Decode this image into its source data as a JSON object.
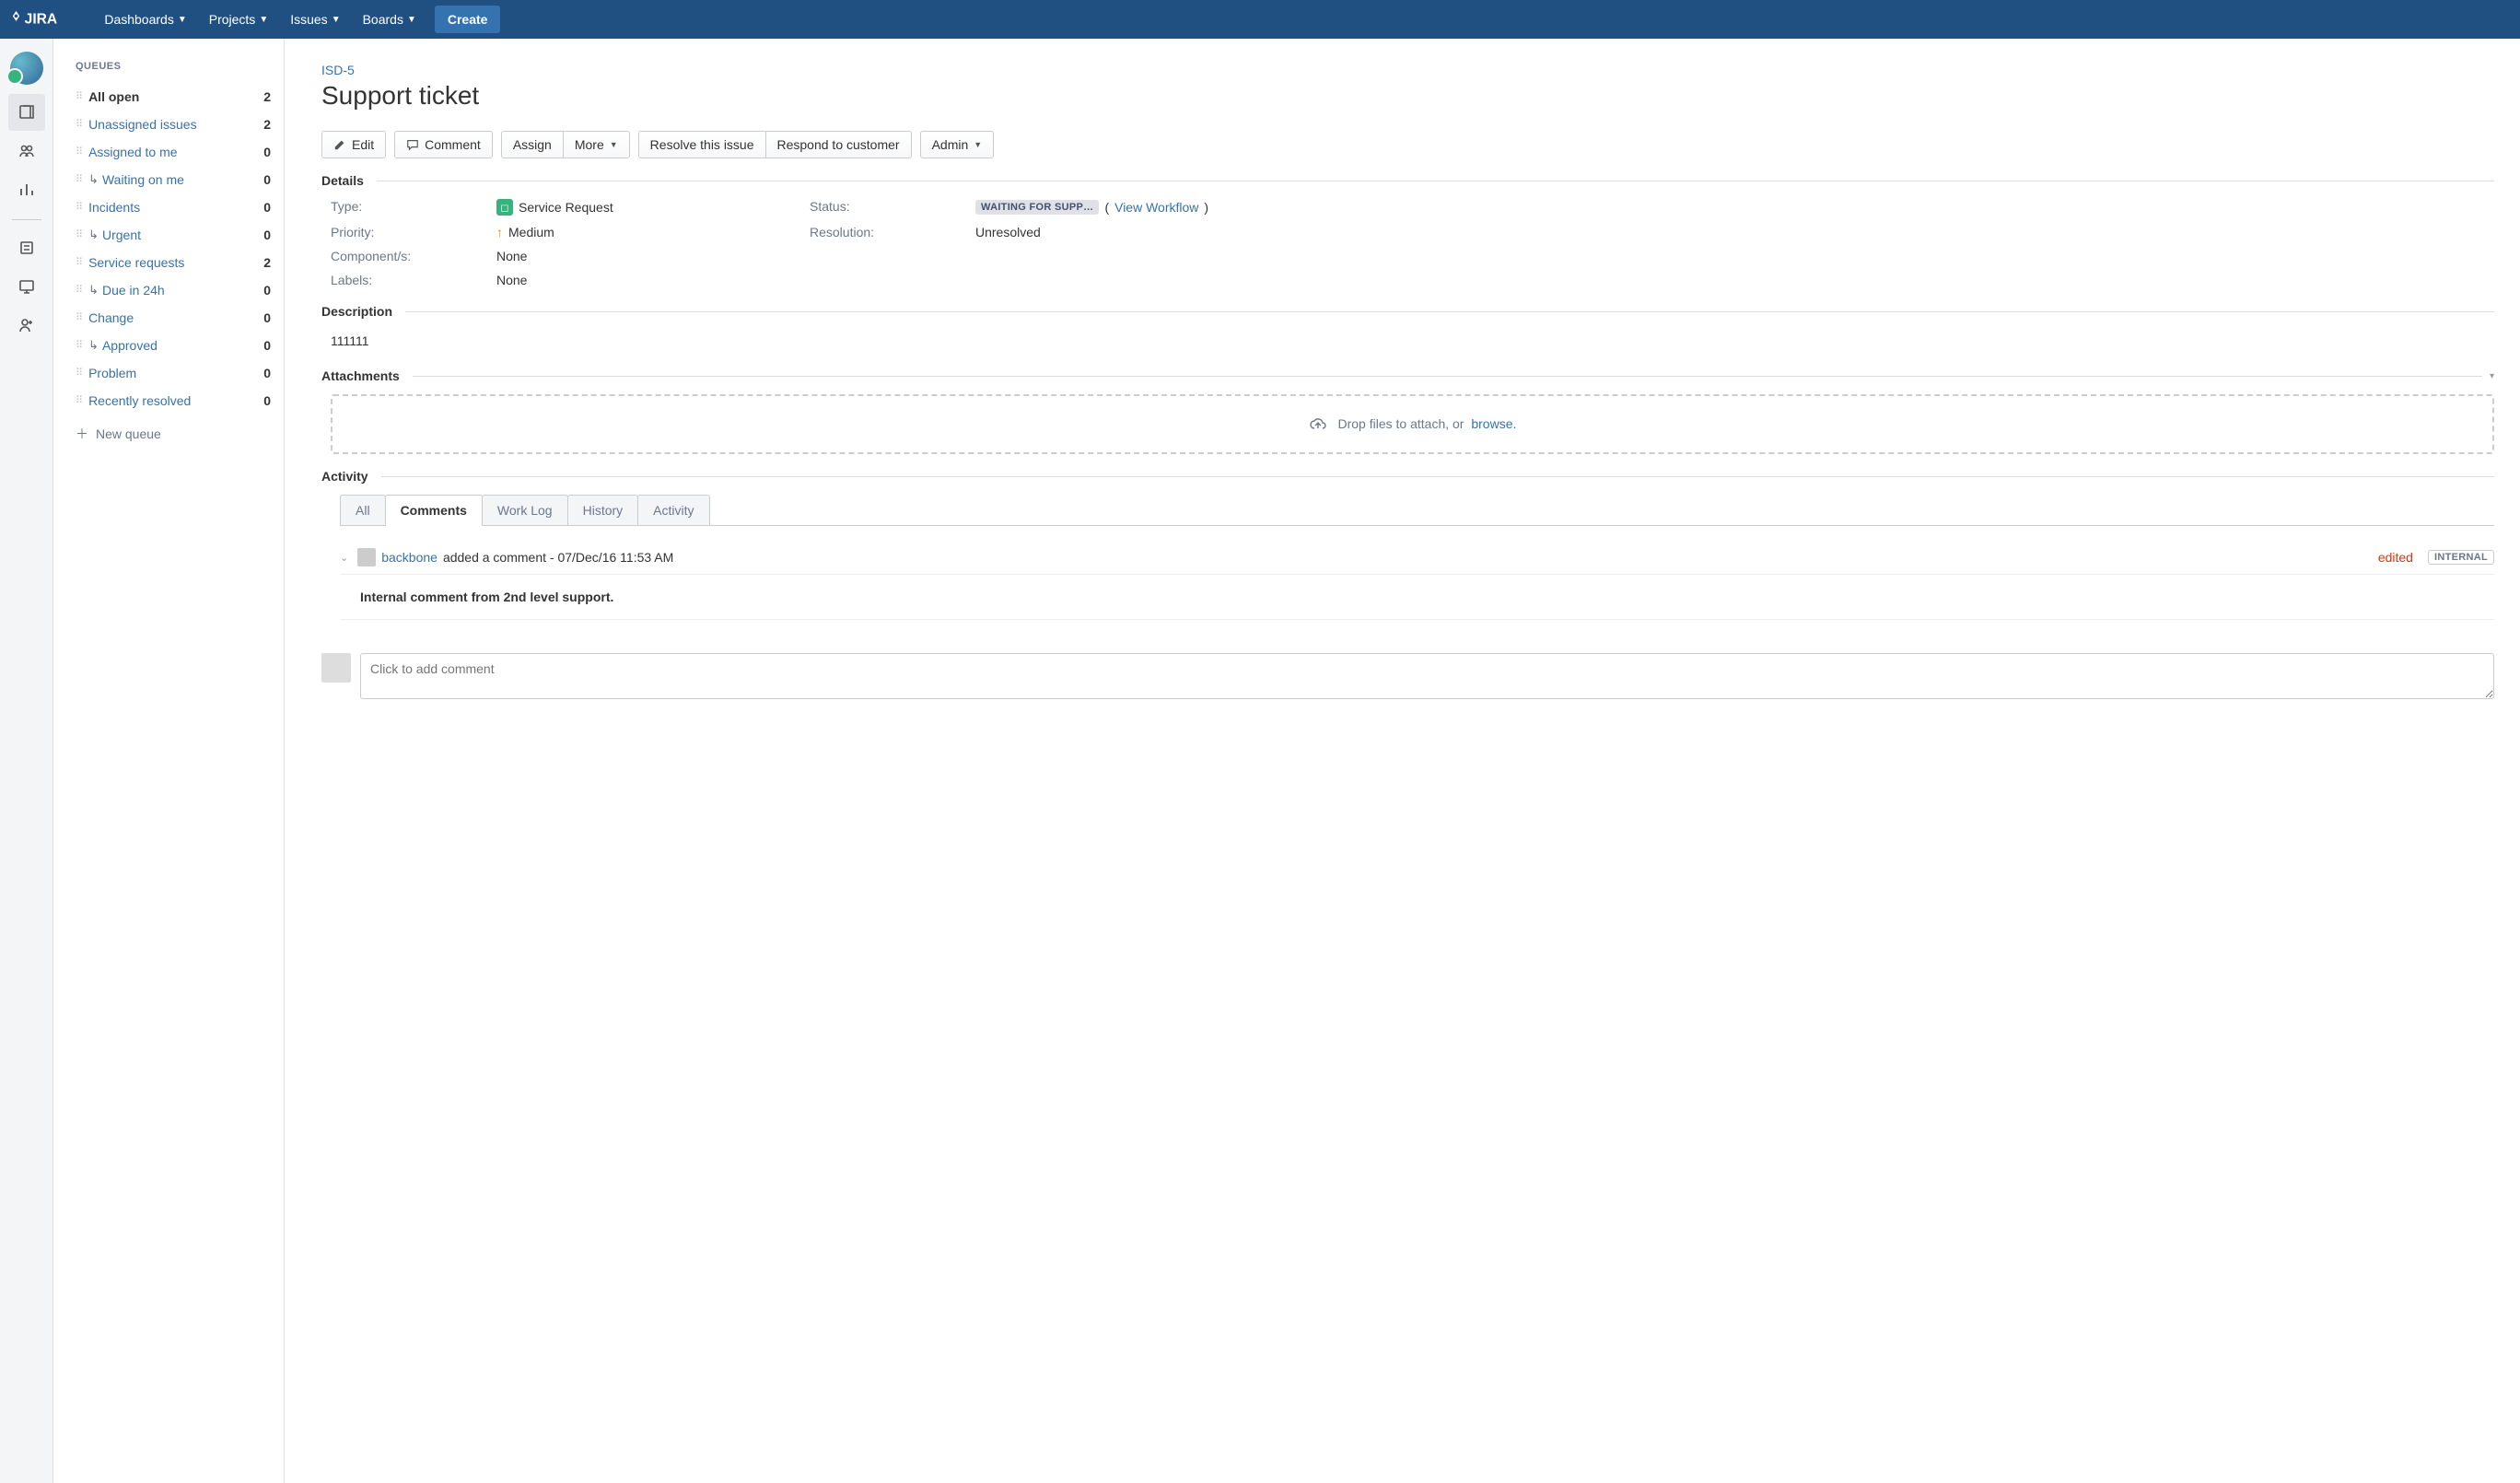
{
  "topnav": {
    "items": [
      "Dashboards",
      "Projects",
      "Issues",
      "Boards"
    ],
    "create_label": "Create"
  },
  "sidebar": {
    "heading": "QUEUES",
    "new_queue_label": "New queue",
    "items": [
      {
        "label": "All open",
        "count": "2",
        "bold": true,
        "sub": false
      },
      {
        "label": "Unassigned issues",
        "count": "2",
        "bold": false,
        "sub": false
      },
      {
        "label": "Assigned to me",
        "count": "0",
        "bold": false,
        "sub": false
      },
      {
        "label": "Waiting on me",
        "count": "0",
        "bold": false,
        "sub": true
      },
      {
        "label": "Incidents",
        "count": "0",
        "bold": false,
        "sub": false
      },
      {
        "label": "Urgent",
        "count": "0",
        "bold": false,
        "sub": true
      },
      {
        "label": "Service requests",
        "count": "2",
        "bold": false,
        "sub": false
      },
      {
        "label": "Due in 24h",
        "count": "0",
        "bold": false,
        "sub": true
      },
      {
        "label": "Change",
        "count": "0",
        "bold": false,
        "sub": false
      },
      {
        "label": "Approved",
        "count": "0",
        "bold": false,
        "sub": true
      },
      {
        "label": "Problem",
        "count": "0",
        "bold": false,
        "sub": false
      },
      {
        "label": "Recently resolved",
        "count": "0",
        "bold": false,
        "sub": false
      }
    ]
  },
  "issue": {
    "key": "ISD-5",
    "title": "Support ticket",
    "toolbar": {
      "edit": "Edit",
      "comment": "Comment",
      "assign": "Assign",
      "more": "More",
      "resolve": "Resolve this issue",
      "respond": "Respond to customer",
      "admin": "Admin"
    },
    "details_heading": "Details",
    "details": {
      "type_label": "Type:",
      "type_value": "Service Request",
      "priority_label": "Priority:",
      "priority_value": "Medium",
      "components_label": "Component/s:",
      "components_value": "None",
      "labels_label": "Labels:",
      "labels_value": "None",
      "status_label": "Status:",
      "status_value": "WAITING FOR SUPP…",
      "view_workflow": "View Workflow",
      "resolution_label": "Resolution:",
      "resolution_value": "Unresolved"
    },
    "description": {
      "heading": "Description",
      "body": "111111"
    },
    "attachments": {
      "heading": "Attachments",
      "drop_text": "Drop files to attach, or",
      "browse_text": "browse."
    },
    "activity": {
      "heading": "Activity",
      "tabs": [
        "All",
        "Comments",
        "Work Log",
        "History",
        "Activity"
      ],
      "active_tab": 1,
      "comment": {
        "author": "backbone",
        "meta": "added a comment - 07/Dec/16 11:53 AM",
        "edited": "edited",
        "badge": "INTERNAL",
        "body": "Internal comment from 2nd level support."
      },
      "add_comment_placeholder": "Click to add comment"
    }
  }
}
